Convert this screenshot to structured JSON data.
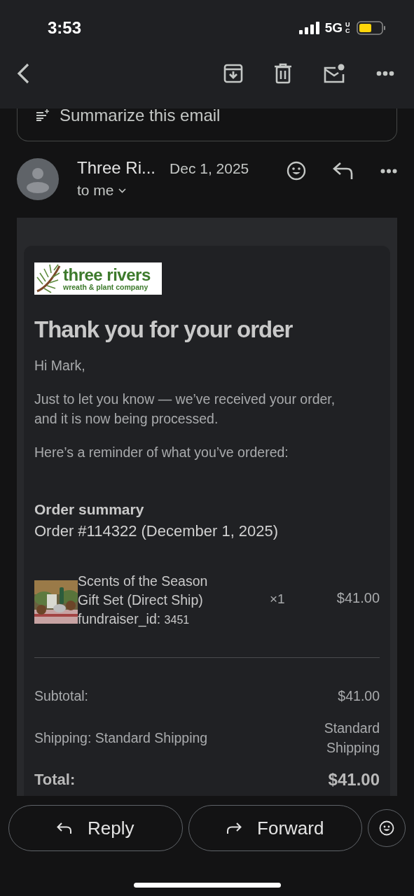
{
  "status_bar": {
    "time": "3:53",
    "network": "5G",
    "network_badge": "UC"
  },
  "summarize": {
    "label": "Summarize this email"
  },
  "message": {
    "sender": "Three Ri...",
    "date": "Dec 1, 2025",
    "recipient": "to me"
  },
  "email": {
    "logo": {
      "name": "three rivers",
      "tagline": "wreath & plant company"
    },
    "heading": "Thank you for your order",
    "greeting": "Hi Mark,",
    "paragraphs": [
      "Just to let you know — we’ve received your order, and it is now being processed.",
      "Here’s a reminder of what you’ve ordered:"
    ],
    "order_title": "Order summary",
    "order_line": "Order #114322 (December 1, 2025)",
    "items": [
      {
        "name": "Scents of the Season Gift Set (Direct Ship)",
        "meta_label": "fundraiser_id:",
        "meta_value": "3451",
        "quantity": "×1",
        "price": "$41.00"
      }
    ],
    "totals": [
      {
        "kind": "line",
        "label": "Subtotal:",
        "value": "$41.00"
      },
      {
        "kind": "line",
        "label": "Shipping: Standard Shipping",
        "value": "Standard Shipping"
      },
      {
        "kind": "total",
        "label": "Total:",
        "value": "$41.00"
      }
    ]
  },
  "actions": [
    "Reply",
    "Forward"
  ]
}
